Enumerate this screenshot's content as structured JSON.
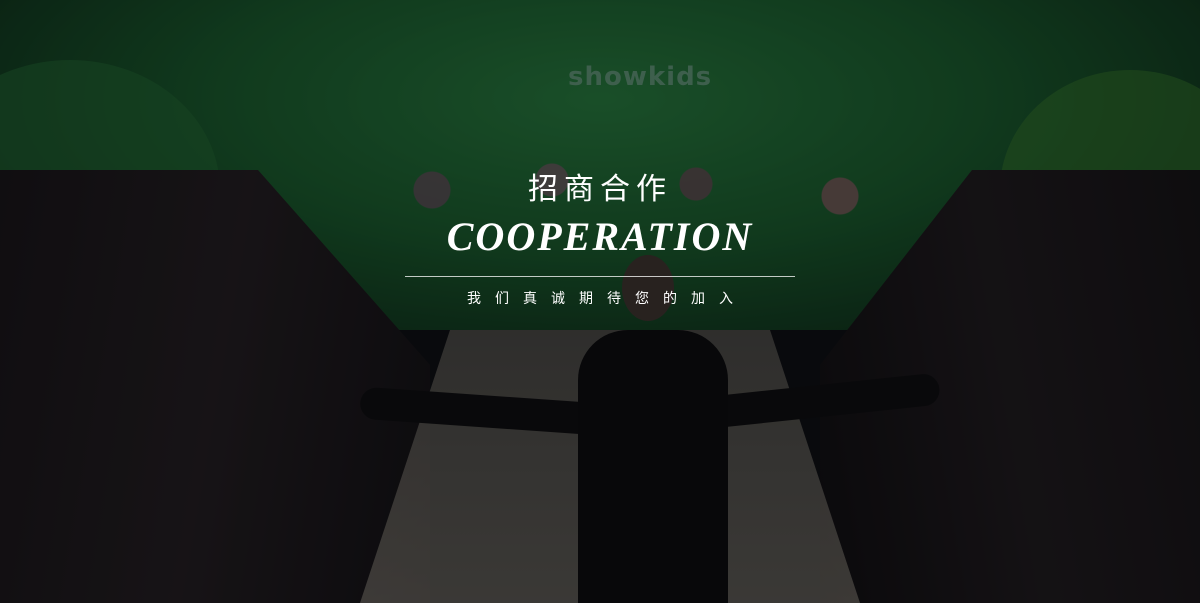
{
  "hero": {
    "backdrop_logo": "showkids",
    "title_cn": "招商合作",
    "title_en": "COOPERATION",
    "subtitle": "我们真诚期待您的加入"
  },
  "colors": {
    "overlay": "#000000",
    "stage_green": "#1f6a36",
    "text": "#ffffff"
  }
}
